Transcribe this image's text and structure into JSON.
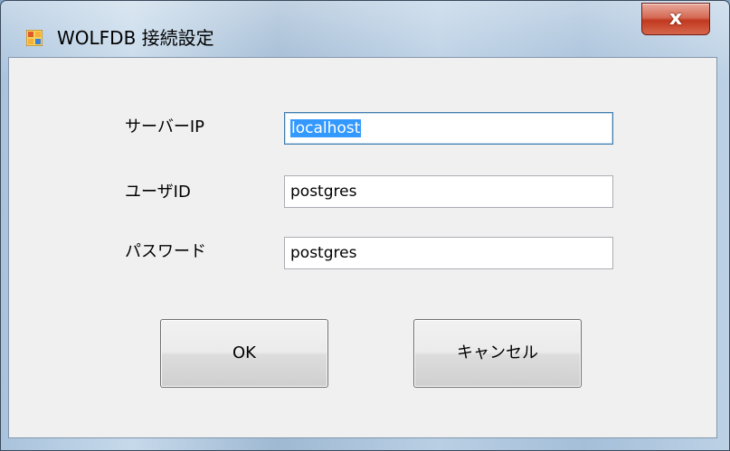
{
  "window": {
    "title": "WOLFDB 接続設定",
    "close_label": "x"
  },
  "form": {
    "server_ip": {
      "label": "サーバーIP",
      "value": "localhost",
      "selected": true
    },
    "user_id": {
      "label": "ユーザID",
      "value": "postgres"
    },
    "password": {
      "label": "パスワード",
      "value": "postgres"
    }
  },
  "buttons": {
    "ok_label": "OK",
    "cancel_label": "キャンセル"
  },
  "colors": {
    "selection": "#3399ff",
    "close_button": "#c0391f"
  }
}
